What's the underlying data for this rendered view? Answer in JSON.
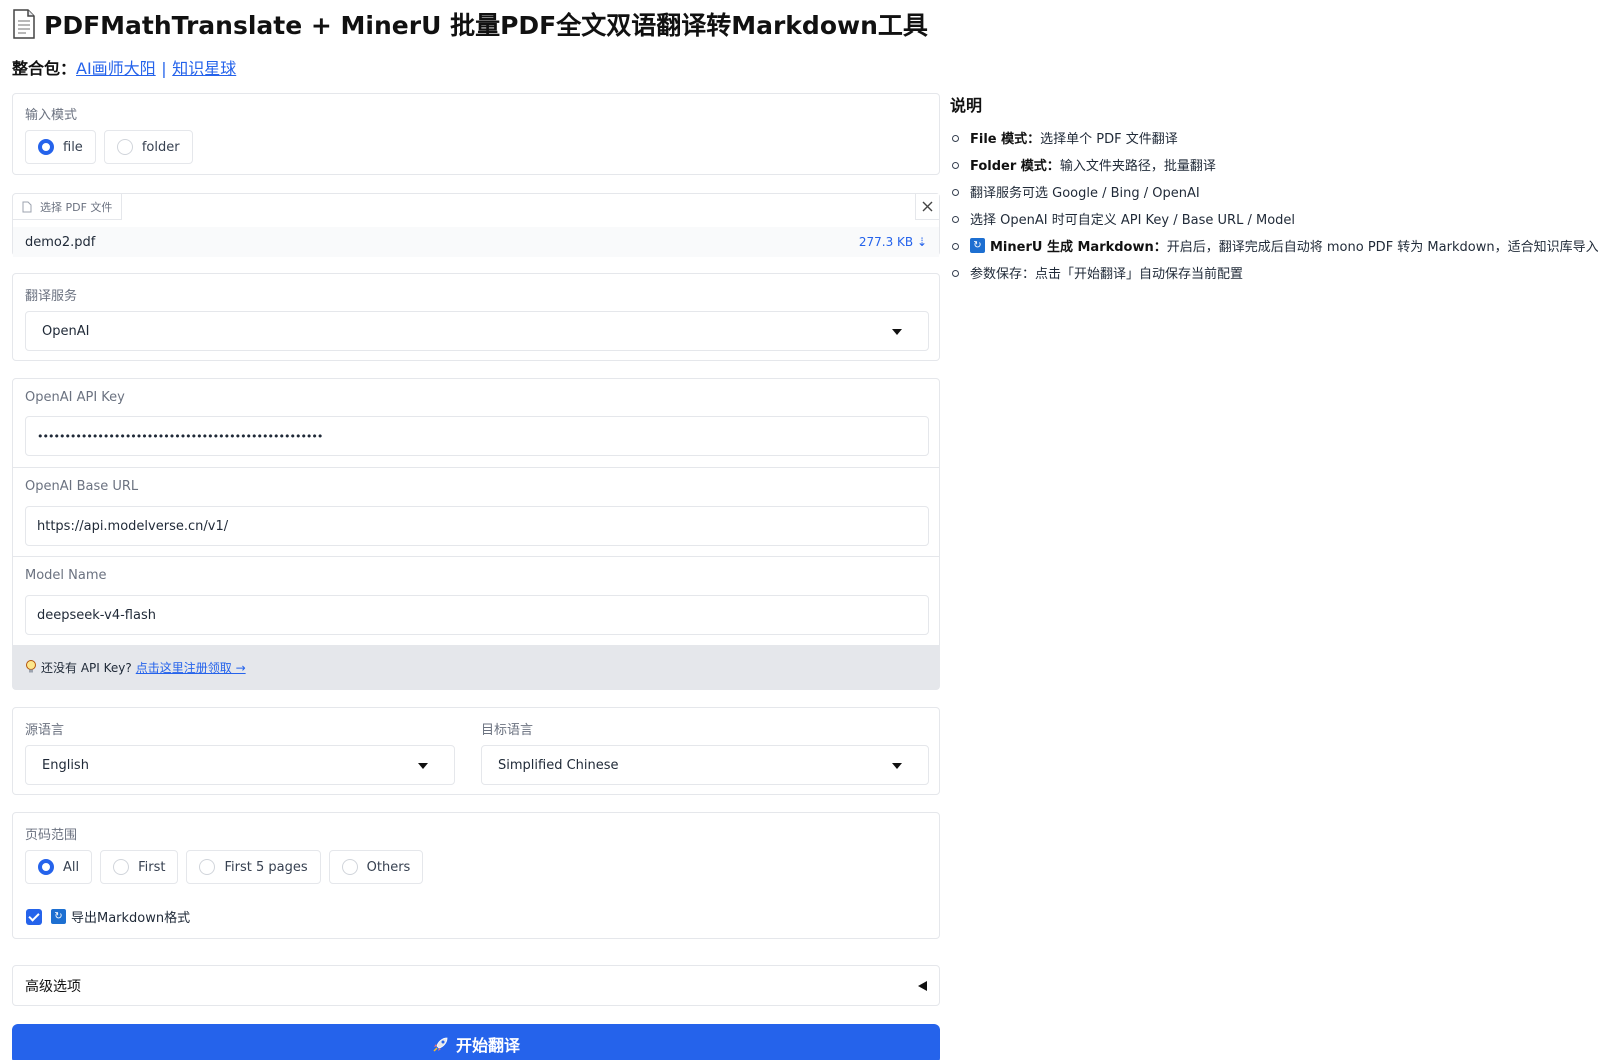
{
  "header": {
    "title": "PDFMathTranslate + MinerU 批量PDF全文双语翻译转Markdown工具",
    "bundle_label": "整合包：",
    "link_ai": "AI画师大阳",
    "separator": "|",
    "link_kb": "知识星球"
  },
  "input_mode": {
    "label": "输入模式",
    "options": [
      "file",
      "folder"
    ],
    "selected": "file"
  },
  "file_upload": {
    "tab_label": "选择 PDF 文件",
    "file_name": "demo2.pdf",
    "file_size": "277.3 KB ⇣"
  },
  "translate_service": {
    "label": "翻译服务",
    "value": "OpenAI"
  },
  "openai": {
    "api_key_label": "OpenAI API Key",
    "api_key_value": "••••••••••••••••••••••••••••••••••••••••••••••••••••",
    "base_url_label": "OpenAI Base URL",
    "base_url_value": "https://api.modelverse.cn/v1/",
    "model_label": "Model Name",
    "model_value": "deepseek-v4-flash",
    "hint_text": "还没有 API Key?",
    "hint_link": "点击这里注册领取 →"
  },
  "languages": {
    "source_label": "源语言",
    "source_value": "English",
    "target_label": "目标语言",
    "target_value": "Simplified Chinese"
  },
  "page_range": {
    "label": "页码范围",
    "options": [
      "All",
      "First",
      "First 5 pages",
      "Others"
    ],
    "selected": "All",
    "markdown_checkbox_label": "导出Markdown格式",
    "markdown_checked": true
  },
  "advanced": {
    "label": "高级选项"
  },
  "start_button": {
    "label": "开始翻译"
  },
  "notes": {
    "title": "说明",
    "items": [
      {
        "bold": "File 模式：",
        "text": "选择单个 PDF 文件翻译"
      },
      {
        "bold": "Folder 模式：",
        "text": "输入文件夹路径，批量翻译"
      },
      {
        "bold": "",
        "text": "翻译服务可选 Google / Bing / OpenAI"
      },
      {
        "bold": "",
        "text": "选择 OpenAI 时可自定义 API Key / Base URL / Model"
      },
      {
        "bold": "MinerU 生成 Markdown：",
        "text": "开启后，翻译完成后自动将 mono PDF 转为 Markdown，适合知识库导入"
      },
      {
        "bold": "",
        "text": "参数保存：点击「开始翻译」自动保存当前配置"
      }
    ]
  },
  "colors": {
    "accent": "#2563eb",
    "border": "#e5e7eb",
    "hint_bg": "#e5e7eb"
  }
}
